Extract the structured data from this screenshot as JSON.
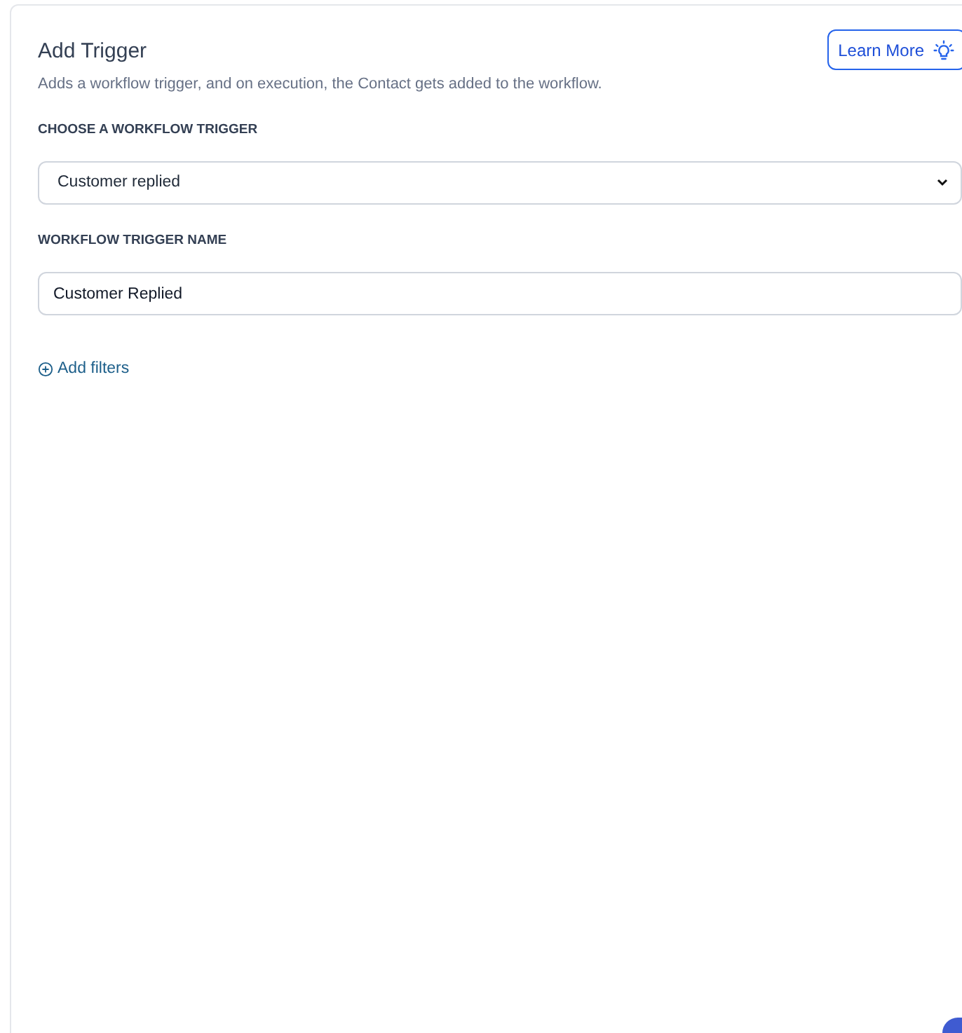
{
  "panel": {
    "title": "Add Trigger",
    "description": "Adds a workflow trigger, and on execution, the Contact gets added to the workflow.",
    "learn_more": "Learn More"
  },
  "trigger_select": {
    "label": "CHOOSE A WORKFLOW TRIGGER",
    "value": "Customer replied"
  },
  "trigger_name": {
    "label": "WORKFLOW TRIGGER NAME",
    "value": "Customer Replied"
  },
  "add_filters": "Add filters"
}
